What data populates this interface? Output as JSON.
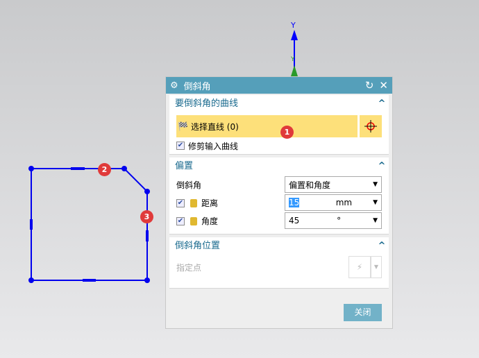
{
  "axis": {
    "y_label": "Y",
    "y2_label": "Y"
  },
  "badges": [
    "1",
    "2",
    "3"
  ],
  "dialog": {
    "title": "倒斜角",
    "section1": {
      "title": "要倒斜角的曲线",
      "select_label": "选择直线 (0)",
      "trim_label": "修剪输入曲线",
      "trim_checked": true
    },
    "section2": {
      "title": "偏置",
      "chamfer_label": "倒斜角",
      "chamfer_value": "偏置和角度",
      "distance_label": "距离",
      "distance_value": "15",
      "distance_unit": "mm",
      "angle_label": "角度",
      "angle_value": "45",
      "angle_unit": "°"
    },
    "section3": {
      "title": "倒斜角位置",
      "point_label": "指定点"
    },
    "close_label": "关闭"
  },
  "colors": {
    "title_bar": "#559fba",
    "select_highlight": "#fde07a",
    "sketch": "#0000ee"
  }
}
